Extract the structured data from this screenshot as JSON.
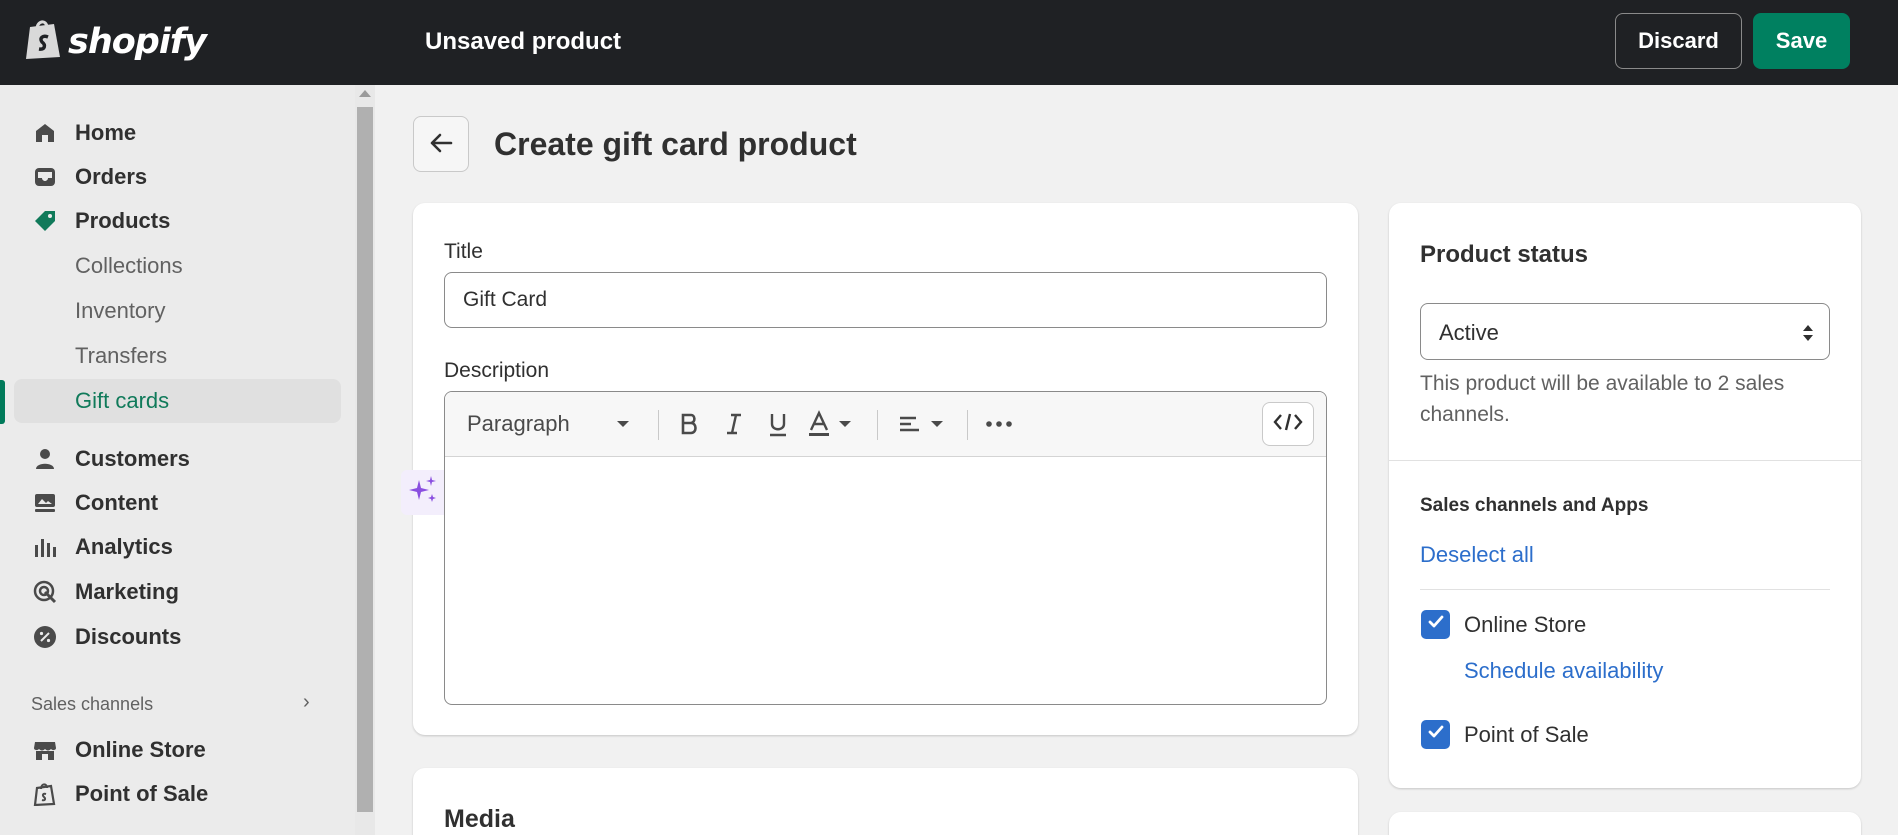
{
  "topbar": {
    "brand": "shopify",
    "page_heading": "Unsaved product",
    "discard_label": "Discard",
    "save_label": "Save"
  },
  "sidebar": {
    "items": [
      {
        "label": "Home",
        "icon": "home-icon"
      },
      {
        "label": "Orders",
        "icon": "inbox-icon"
      },
      {
        "label": "Products",
        "icon": "tag-icon"
      },
      {
        "label": "Collections"
      },
      {
        "label": "Inventory"
      },
      {
        "label": "Transfers"
      },
      {
        "label": "Gift cards",
        "active": true
      },
      {
        "label": "Customers",
        "icon": "person-icon"
      },
      {
        "label": "Content",
        "icon": "content-icon"
      },
      {
        "label": "Analytics",
        "icon": "bar-chart-icon"
      },
      {
        "label": "Marketing",
        "icon": "target-icon"
      },
      {
        "label": "Discounts",
        "icon": "discount-icon"
      }
    ],
    "sales_channels_label": "Sales channels",
    "channels": [
      {
        "label": "Online Store",
        "icon": "store-icon"
      },
      {
        "label": "Point of Sale",
        "icon": "pos-icon"
      }
    ]
  },
  "main": {
    "title": "Create gift card product",
    "title_field": {
      "label": "Title",
      "value": "Gift Card"
    },
    "description": {
      "label": "Description",
      "paragraph_select": "Paragraph"
    },
    "media_title": "Media"
  },
  "status_card": {
    "title": "Product status",
    "status_value": "Active",
    "help_text": "This product will be available to 2 sales channels.",
    "channels_title": "Sales channels and Apps",
    "deselect_all": "Deselect all",
    "online_store": {
      "label": "Online Store",
      "checked": true
    },
    "schedule_availability": "Schedule availability",
    "point_of_sale": {
      "label": "Point of Sale",
      "checked": true
    }
  },
  "colors": {
    "topbar_bg": "#1f2124",
    "primary_green": "#008060",
    "link_blue": "#2c6ecb",
    "ai_purple": "#8a4fe0"
  }
}
